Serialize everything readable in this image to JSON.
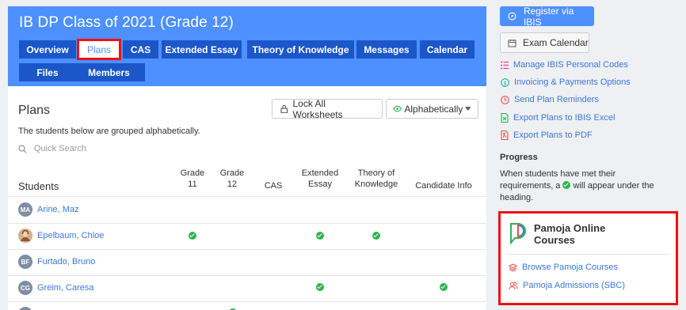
{
  "header": {
    "title": "IB DP Class of 2021 (Grade 12)",
    "tabs": [
      "Overview",
      "Plans",
      "CAS",
      "Extended Essay",
      "Theory of Knowledge",
      "Messages",
      "Calendar",
      "Files",
      "Members"
    ]
  },
  "plans": {
    "title": "Plans",
    "lock_button": "Lock All Worksheets",
    "sort_button": "Alphabetically",
    "description": "The students below are grouped alphabetically.",
    "search_placeholder": "Quick Search",
    "students_heading": "Students",
    "columns": {
      "grade11_a": "Grade",
      "grade11_b": "11",
      "grade12_a": "Grade",
      "grade12_b": "12",
      "cas": "CAS",
      "ee_a": "Extended",
      "ee_b": "Essay",
      "tok_a": "Theory of",
      "tok_b": "Knowledge",
      "candidate": "Candidate Info"
    },
    "students": [
      {
        "initials": "MA",
        "name": "Arine, Maz",
        "grade11": false,
        "grade12": false,
        "cas": false,
        "ee": false,
        "tok": false,
        "candidate": false
      },
      {
        "initials": "",
        "name": "Epelbaum, Chloe",
        "grade11": true,
        "grade12": false,
        "cas": false,
        "ee": true,
        "tok": true,
        "candidate": false
      },
      {
        "initials": "BF",
        "name": "Furtado, Bruno",
        "grade11": false,
        "grade12": false,
        "cas": false,
        "ee": false,
        "tok": false,
        "candidate": false
      },
      {
        "initials": "CG",
        "name": "Greim, Caresa",
        "grade11": false,
        "grade12": false,
        "cas": false,
        "ee": true,
        "tok": false,
        "candidate": true
      }
    ]
  },
  "sidebar": {
    "register_button": "Register via IBIS",
    "exam_calendar_button": "Exam Calendar",
    "links": [
      {
        "label": "Manage IBIS Personal Codes",
        "icon": "list-icon",
        "color": "#e0409a"
      },
      {
        "label": "Invoicing & Payments Options",
        "icon": "dollar-icon",
        "color": "#19b3a6"
      },
      {
        "label": "Send Plan Reminders",
        "icon": "clock-icon",
        "color": "#e64d4d"
      },
      {
        "label": "Export Plans to IBIS Excel",
        "icon": "excel-icon",
        "color": "#2fb352"
      },
      {
        "label": "Export Plans to PDF",
        "icon": "pdf-icon",
        "color": "#e64d4d"
      }
    ],
    "progress_title": "Progress",
    "progress_text_before": "When students have met their requirements, a ",
    "progress_text_after": " will appear under the heading.",
    "pamoja": {
      "title": "Pamoja Online Courses",
      "links": [
        "Browse Pamoja Courses",
        "Pamoja Admissions (SBC)"
      ]
    }
  },
  "colors": {
    "brand_blue": "#4d90fe",
    "tab_blue": "#1b57c9",
    "link_blue": "#3b77d8",
    "check_green": "#2fb352",
    "highlight_red": "#ee1111"
  }
}
